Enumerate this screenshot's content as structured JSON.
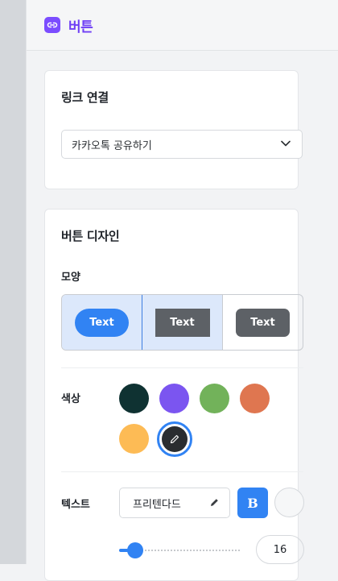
{
  "header": {
    "title": "버튼"
  },
  "link_section": {
    "title": "링크 연결",
    "select_value": "카카오톡 공유하기"
  },
  "design_section": {
    "title": "버튼 디자인",
    "shape_label": "모양",
    "shapes": [
      {
        "label": "Text",
        "style": "pill",
        "selected": true
      },
      {
        "label": "Text",
        "style": "square",
        "selected": true
      },
      {
        "label": "Text",
        "style": "rounded",
        "selected": false
      }
    ],
    "color_label": "색상",
    "colors": [
      "#0f3232",
      "#7b55f0",
      "#72b25a",
      "#df7650",
      "#fdbb55"
    ],
    "picker_color": "#2a2d30",
    "text_label": "텍스트",
    "font_value": "프리텐다드",
    "bold_label": "B",
    "font_size": "16",
    "font_size_level": 0.05
  }
}
